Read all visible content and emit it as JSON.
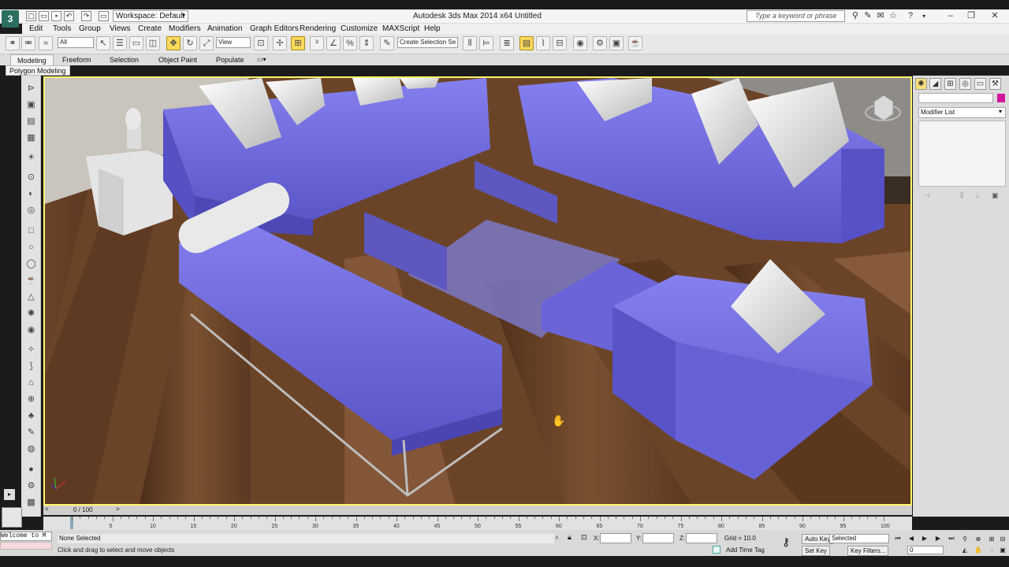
{
  "titlebar": {
    "app_title": "Autodesk 3ds Max  2014 x64       Untitled",
    "workspace_label": "Workspace: Default",
    "search_placeholder": "Type a keyword or phrase"
  },
  "menu": [
    "Edit",
    "Tools",
    "Group",
    "Views",
    "Create",
    "Modifiers",
    "Animation",
    "Graph Editors",
    "Rendering",
    "Customize",
    "MAXScript",
    "Help"
  ],
  "toolbar": {
    "selection_filter": "All",
    "reference_coord": "View",
    "named_selection_placeholder": "Create Selection Se"
  },
  "ribbon": {
    "tabs": [
      "Modeling",
      "Freeform",
      "Selection",
      "Object Paint",
      "Populate"
    ],
    "active_tab": "Modeling",
    "sub_tab": "Polygon Modeling"
  },
  "command_panel": {
    "modifier_list": "Modifier List",
    "object_color": "#d4149b"
  },
  "timeline": {
    "frame_label": "0 / 100",
    "ticks": [
      "5",
      "10",
      "15",
      "20",
      "25",
      "30",
      "35",
      "40",
      "45",
      "50",
      "55",
      "60",
      "65",
      "70",
      "75",
      "80",
      "85",
      "90",
      "95",
      "100"
    ]
  },
  "status": {
    "maxscript_text": "Welcome to M",
    "selection": "None Selected",
    "prompt": "Click and drag to select and move objects",
    "x_label": "X:",
    "y_label": "Y:",
    "z_label": "Z:",
    "grid": "Grid = 10.0",
    "add_time_tag": "Add Time Tag",
    "auto_key": "Auto Key",
    "set_key": "Set Key",
    "selected": "Selected",
    "key_filters": "Key Filters...",
    "current_frame": "0"
  },
  "colors": {
    "viewport_border": "#fff56b",
    "sofa": "#6a64d8",
    "floor": "#6b4428",
    "active_tool": "#fcd95a"
  }
}
